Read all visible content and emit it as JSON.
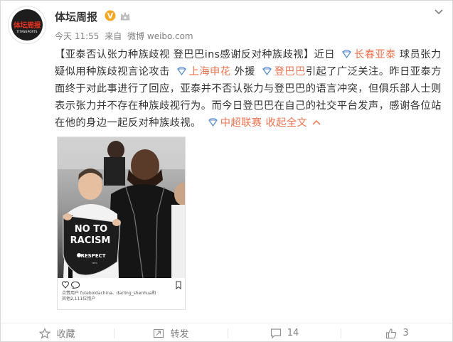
{
  "account": {
    "name": "体坛周报",
    "avatar_text": "体坛周报",
    "avatar_subtext": "TITANSPORTS",
    "time": "今天 11:55",
    "source_prefix": "来自",
    "source": "微博 weibo.com"
  },
  "post": {
    "p1": "【亚泰否认张力种族歧视 登巴巴ins感谢反对种族歧视】近日",
    "tag1": "长春亚泰",
    "p2": "球员张力疑似用种族歧视言论攻击",
    "tag2": "上海申花",
    "p3": "外援",
    "tag3": "登巴巴",
    "p4": "引起了广泛关注。昨日亚泰方面终于对此事进行了回应，亚泰并不否认张力与登巴巴的语言冲突，但俱乐部人士则表示张力并不存在种族歧视行为。而今日登巴巴在自己的社交平台发声，感谢各位站在他的身边一起反对种族歧视。",
    "tag4": "中超联赛",
    "collapse_label": "收起全文"
  },
  "image": {
    "banner_line1": "NO TO",
    "banner_line2": "RACISM",
    "banner_line3": "RESPECT",
    "liked_line1": "点赞用户 futeboldachina、darling_shenhua和",
    "liked_line2": "其他2,111位用户"
  },
  "actions": {
    "favorite": "收藏",
    "repost": "转发",
    "comment": "14",
    "like": "3"
  },
  "colors": {
    "link": "#eb7350",
    "verified": "#f6a623",
    "text": "#333333",
    "muted": "#808080"
  },
  "icons": [
    "verified-icon",
    "vip-icon",
    "chevron-down-icon",
    "topic-tag-icon",
    "star-icon",
    "repost-icon",
    "comment-icon",
    "like-icon",
    "instagram-heart-icon",
    "instagram-comment-icon",
    "instagram-bookmark-icon"
  ]
}
